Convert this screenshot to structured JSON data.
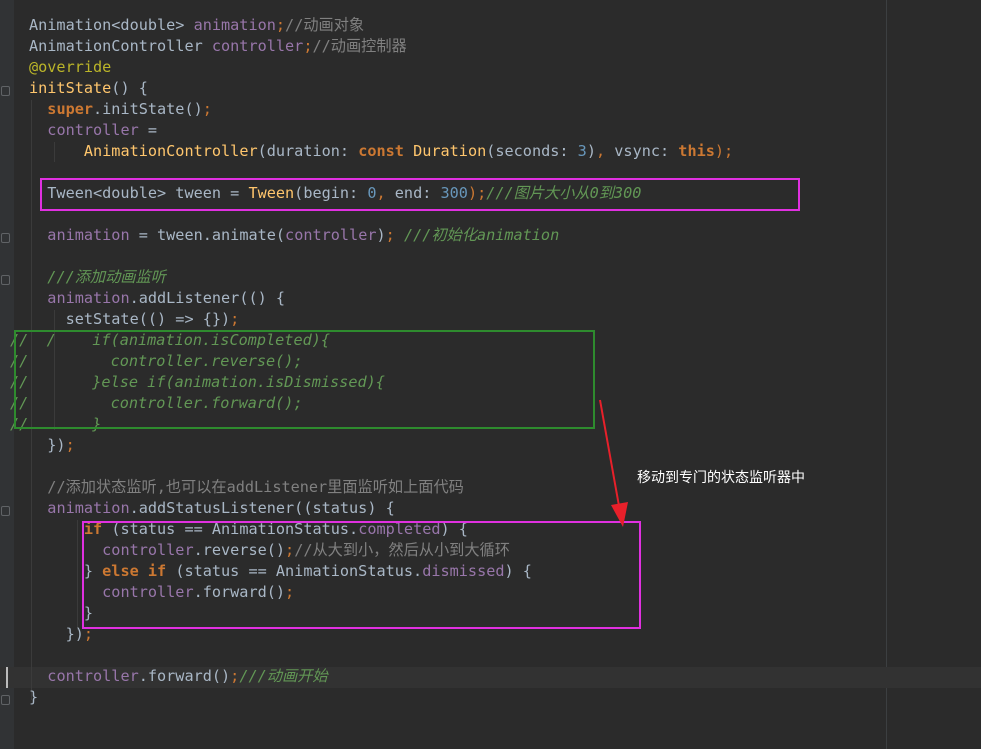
{
  "editor": {
    "lines": [
      [
        {
          "t": "Animation<double> ",
          "c": "plain"
        },
        {
          "t": "animation",
          "c": "fld"
        },
        {
          "t": ";",
          "c": "punc"
        },
        {
          "t": "//动画对象",
          "c": "cm"
        }
      ],
      [
        {
          "t": "AnimationController ",
          "c": "plain"
        },
        {
          "t": "controller",
          "c": "fld"
        },
        {
          "t": ";",
          "c": "punc"
        },
        {
          "t": "//动画控制器",
          "c": "cm"
        }
      ],
      [
        {
          "t": "@override",
          "c": "ann"
        }
      ],
      [
        {
          "t": "initState",
          "c": "fn"
        },
        {
          "t": "() {",
          "c": "plain"
        }
      ],
      [
        {
          "t": "  ",
          "c": "plain"
        },
        {
          "t": "super",
          "c": "kw"
        },
        {
          "t": ".initState()",
          "c": "plain"
        },
        {
          "t": ";",
          "c": "punc"
        }
      ],
      [
        {
          "t": "  ",
          "c": "plain"
        },
        {
          "t": "controller",
          "c": "fld"
        },
        {
          "t": " =",
          "c": "plain"
        }
      ],
      [
        {
          "t": "      ",
          "c": "plain"
        },
        {
          "t": "AnimationController",
          "c": "fn"
        },
        {
          "t": "(duration: ",
          "c": "plain"
        },
        {
          "t": "const ",
          "c": "kw"
        },
        {
          "t": "Duration",
          "c": "fn"
        },
        {
          "t": "(seconds: ",
          "c": "plain"
        },
        {
          "t": "3",
          "c": "num"
        },
        {
          "t": ")",
          "c": "plain"
        },
        {
          "t": ", ",
          "c": "punc"
        },
        {
          "t": "vsync: ",
          "c": "plain"
        },
        {
          "t": "this",
          "c": "kw"
        },
        {
          "t": ");",
          "c": "punc"
        }
      ],
      [
        {
          "t": "",
          "c": "plain"
        }
      ],
      [
        {
          "t": "  Tween<double> tween = ",
          "c": "plain"
        },
        {
          "t": "Tween",
          "c": "fn"
        },
        {
          "t": "(begin: ",
          "c": "plain"
        },
        {
          "t": "0",
          "c": "num"
        },
        {
          "t": ", ",
          "c": "punc"
        },
        {
          "t": "end: ",
          "c": "plain"
        },
        {
          "t": "300",
          "c": "num"
        },
        {
          "t": ");",
          "c": "punc"
        },
        {
          "t": "///图片大小从0到300",
          "c": "doc"
        }
      ],
      [
        {
          "t": "",
          "c": "plain"
        }
      ],
      [
        {
          "t": "  ",
          "c": "plain"
        },
        {
          "t": "animation",
          "c": "fld"
        },
        {
          "t": " = tween.animate(",
          "c": "plain"
        },
        {
          "t": "controller",
          "c": "fld"
        },
        {
          "t": ")",
          "c": "plain"
        },
        {
          "t": "; ",
          "c": "punc"
        },
        {
          "t": "///初始化animation",
          "c": "doc"
        }
      ],
      [
        {
          "t": "",
          "c": "plain"
        }
      ],
      [
        {
          "t": "  ",
          "c": "plain"
        },
        {
          "t": "///添加动画监听",
          "c": "doc"
        }
      ],
      [
        {
          "t": "  ",
          "c": "plain"
        },
        {
          "t": "animation",
          "c": "fld"
        },
        {
          "t": ".addListener(() {",
          "c": "plain"
        }
      ],
      [
        {
          "t": "    setState(() => {})",
          "c": "plain"
        },
        {
          "t": ";",
          "c": "punc"
        }
      ],
      [
        {
          "t": "//  /    if(animation.isCompleted){",
          "c": "doc"
        }
      ],
      [
        {
          "t": "//         controller.reverse();",
          "c": "doc"
        }
      ],
      [
        {
          "t": "//       }else if(animation.isDismissed){",
          "c": "doc"
        }
      ],
      [
        {
          "t": "//         controller.forward();",
          "c": "doc"
        }
      ],
      [
        {
          "t": "//       }",
          "c": "doc"
        }
      ],
      [
        {
          "t": "  })",
          "c": "plain"
        },
        {
          "t": ";",
          "c": "punc"
        }
      ],
      [
        {
          "t": "",
          "c": "plain"
        }
      ],
      [
        {
          "t": "  ",
          "c": "plain"
        },
        {
          "t": "//添加状态监听,也可以在addListener里面监听如上面代码",
          "c": "cm"
        }
      ],
      [
        {
          "t": "  ",
          "c": "plain"
        },
        {
          "t": "animation",
          "c": "fld"
        },
        {
          "t": ".addStatusListener((status) {",
          "c": "plain"
        }
      ],
      [
        {
          "t": "      ",
          "c": "plain"
        },
        {
          "t": "if ",
          "c": "kw"
        },
        {
          "t": "(status == AnimationStatus.",
          "c": "plain"
        },
        {
          "t": "completed",
          "c": "fld"
        },
        {
          "t": ") {",
          "c": "plain"
        }
      ],
      [
        {
          "t": "        ",
          "c": "plain"
        },
        {
          "t": "controller",
          "c": "fld"
        },
        {
          "t": ".reverse()",
          "c": "plain"
        },
        {
          "t": ";",
          "c": "punc"
        },
        {
          "t": "//从大到小，然后从小到大循环",
          "c": "cm"
        }
      ],
      [
        {
          "t": "      } ",
          "c": "plain"
        },
        {
          "t": "else if ",
          "c": "kw"
        },
        {
          "t": "(status == AnimationStatus.",
          "c": "plain"
        },
        {
          "t": "dismissed",
          "c": "fld"
        },
        {
          "t": ") {",
          "c": "plain"
        }
      ],
      [
        {
          "t": "        ",
          "c": "plain"
        },
        {
          "t": "controller",
          "c": "fld"
        },
        {
          "t": ".forward()",
          "c": "plain"
        },
        {
          "t": ";",
          "c": "punc"
        }
      ],
      [
        {
          "t": "      }",
          "c": "plain"
        }
      ],
      [
        {
          "t": "    })",
          "c": "plain"
        },
        {
          "t": ";",
          "c": "punc"
        }
      ],
      [
        {
          "t": "",
          "c": "plain"
        }
      ],
      [
        {
          "t": "  ",
          "c": "plain"
        },
        {
          "t": "controller",
          "c": "fld"
        },
        {
          "t": ".forward()",
          "c": "plain"
        },
        {
          "t": ";",
          "c": "punc"
        },
        {
          "t": "///动画开始",
          "c": "doc"
        }
      ],
      [
        {
          "t": "}",
          "c": "plain"
        }
      ]
    ]
  },
  "annotation": {
    "note_text": "移动到专门的状态监听器中",
    "colors": {
      "magenta_box": "#e030e0",
      "green_box": "#2e8b2e",
      "arrow": "#e8202a"
    }
  },
  "theme": {
    "background": "#2b2b2b",
    "gutter": "#313335",
    "text": "#a9b7c6",
    "keyword": "#cc7832",
    "field": "#9876aa",
    "number": "#6897bb",
    "function": "#ffc66d",
    "comment": "#808080",
    "doc_comment": "#629755"
  }
}
